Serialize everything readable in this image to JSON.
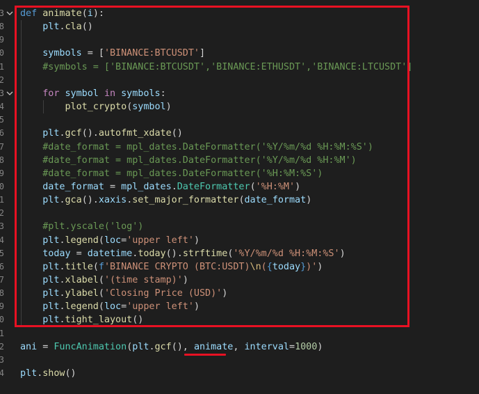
{
  "editor": {
    "lines": [
      {
        "n": "3",
        "fold": true,
        "tokens": [
          [
            "kw",
            "def"
          ],
          [
            "pun",
            " "
          ],
          [
            "fn",
            "animate"
          ],
          [
            "pun",
            "("
          ],
          [
            "var",
            "i"
          ],
          [
            "pun",
            "):"
          ]
        ]
      },
      {
        "n": "8",
        "tokens": [
          [
            "pun",
            "    "
          ],
          [
            "var",
            "plt"
          ],
          [
            "pun",
            "."
          ],
          [
            "fn",
            "cla"
          ],
          [
            "pun",
            "()"
          ]
        ]
      },
      {
        "n": "9",
        "tokens": []
      },
      {
        "n": "0",
        "tokens": [
          [
            "pun",
            "    "
          ],
          [
            "var",
            "symbols"
          ],
          [
            "pun",
            " = ["
          ],
          [
            "str",
            "'BINANCE:BTCUSDT'"
          ],
          [
            "pun",
            "]"
          ]
        ]
      },
      {
        "n": "1",
        "tokens": [
          [
            "pun",
            "    "
          ],
          [
            "com",
            "#symbols = ['BINANCE:BTCUSDT','BINANCE:ETHUSDT','BINANCE:LTCUSDT']"
          ]
        ]
      },
      {
        "n": "2",
        "tokens": []
      },
      {
        "n": "3",
        "fold": true,
        "tokens": [
          [
            "pun",
            "    "
          ],
          [
            "ctl",
            "for"
          ],
          [
            "pun",
            " "
          ],
          [
            "var",
            "symbol"
          ],
          [
            "pun",
            " "
          ],
          [
            "ctl",
            "in"
          ],
          [
            "pun",
            " "
          ],
          [
            "var",
            "symbols"
          ],
          [
            "pun",
            ":"
          ]
        ]
      },
      {
        "n": "4",
        "tokens": [
          [
            "pun",
            "        "
          ],
          [
            "fn",
            "plot_crypto"
          ],
          [
            "pun",
            "("
          ],
          [
            "var",
            "symbol"
          ],
          [
            "pun",
            ")"
          ]
        ]
      },
      {
        "n": "5",
        "tokens": []
      },
      {
        "n": "6",
        "tokens": [
          [
            "pun",
            "    "
          ],
          [
            "var",
            "plt"
          ],
          [
            "pun",
            "."
          ],
          [
            "fn",
            "gcf"
          ],
          [
            "pun",
            "()."
          ],
          [
            "fn",
            "autofmt_xdate"
          ],
          [
            "pun",
            "()"
          ]
        ]
      },
      {
        "n": "7",
        "tokens": [
          [
            "pun",
            "    "
          ],
          [
            "com",
            "#date_format = mpl_dates.DateFormatter('%Y/%m/%d %H:%M:%S')"
          ]
        ]
      },
      {
        "n": "8",
        "tokens": [
          [
            "pun",
            "    "
          ],
          [
            "com",
            "#date_format = mpl_dates.DateFormatter('%Y/%m/%d %H:%M')"
          ]
        ]
      },
      {
        "n": "9",
        "tokens": [
          [
            "pun",
            "    "
          ],
          [
            "com",
            "#date_format = mpl_dates.DateFormatter('%H:%M:%S')"
          ]
        ]
      },
      {
        "n": "0",
        "tokens": [
          [
            "pun",
            "    "
          ],
          [
            "var",
            "date_format"
          ],
          [
            "pun",
            " = "
          ],
          [
            "var",
            "mpl_dates"
          ],
          [
            "pun",
            "."
          ],
          [
            "cls",
            "DateFormatter"
          ],
          [
            "pun",
            "("
          ],
          [
            "str",
            "'%H:%M'"
          ],
          [
            "pun",
            ")"
          ]
        ]
      },
      {
        "n": "1",
        "tokens": [
          [
            "pun",
            "    "
          ],
          [
            "var",
            "plt"
          ],
          [
            "pun",
            "."
          ],
          [
            "fn",
            "gca"
          ],
          [
            "pun",
            "()."
          ],
          [
            "var",
            "xaxis"
          ],
          [
            "pun",
            "."
          ],
          [
            "fn",
            "set_major_formatter"
          ],
          [
            "pun",
            "("
          ],
          [
            "var",
            "date_format"
          ],
          [
            "pun",
            ")"
          ]
        ]
      },
      {
        "n": "2",
        "tokens": []
      },
      {
        "n": "3",
        "tokens": [
          [
            "pun",
            "    "
          ],
          [
            "com",
            "#plt.yscale('log')"
          ]
        ]
      },
      {
        "n": "4",
        "tokens": [
          [
            "pun",
            "    "
          ],
          [
            "var",
            "plt"
          ],
          [
            "pun",
            "."
          ],
          [
            "fn",
            "legend"
          ],
          [
            "pun",
            "("
          ],
          [
            "var",
            "loc"
          ],
          [
            "pun",
            "="
          ],
          [
            "str",
            "'upper left'"
          ],
          [
            "pun",
            ")"
          ]
        ]
      },
      {
        "n": "5",
        "tokens": [
          [
            "pun",
            "    "
          ],
          [
            "var",
            "today"
          ],
          [
            "pun",
            " = "
          ],
          [
            "var",
            "datetime"
          ],
          [
            "pun",
            "."
          ],
          [
            "fn",
            "today"
          ],
          [
            "pun",
            "()."
          ],
          [
            "fn",
            "strftime"
          ],
          [
            "pun",
            "("
          ],
          [
            "str",
            "'%Y/%m/%d %H:%M:%S'"
          ],
          [
            "pun",
            ")"
          ]
        ]
      },
      {
        "n": "6",
        "tokens": [
          [
            "pun",
            "    "
          ],
          [
            "var",
            "plt"
          ],
          [
            "pun",
            "."
          ],
          [
            "fn",
            "title"
          ],
          [
            "pun",
            "("
          ],
          [
            "kw",
            "f"
          ],
          [
            "str",
            "'BINANCE CRYPTO (BTC:USDT)"
          ],
          [
            "esc",
            "\\n"
          ],
          [
            "str",
            "("
          ],
          [
            "kw",
            "{"
          ],
          [
            "var",
            "today"
          ],
          [
            "kw",
            "}"
          ],
          [
            "str",
            ")'"
          ],
          [
            "pun",
            ")"
          ]
        ]
      },
      {
        "n": "7",
        "tokens": [
          [
            "pun",
            "    "
          ],
          [
            "var",
            "plt"
          ],
          [
            "pun",
            "."
          ],
          [
            "fn",
            "xlabel"
          ],
          [
            "pun",
            "("
          ],
          [
            "str",
            "'(time stamp)'"
          ],
          [
            "pun",
            ")"
          ]
        ]
      },
      {
        "n": "8",
        "tokens": [
          [
            "pun",
            "    "
          ],
          [
            "var",
            "plt"
          ],
          [
            "pun",
            "."
          ],
          [
            "fn",
            "ylabel"
          ],
          [
            "pun",
            "("
          ],
          [
            "str",
            "'Closing Price (USD)'"
          ],
          [
            "pun",
            ")"
          ]
        ]
      },
      {
        "n": "9",
        "tokens": [
          [
            "pun",
            "    "
          ],
          [
            "var",
            "plt"
          ],
          [
            "pun",
            "."
          ],
          [
            "fn",
            "legend"
          ],
          [
            "pun",
            "("
          ],
          [
            "var",
            "loc"
          ],
          [
            "pun",
            "="
          ],
          [
            "str",
            "'upper left'"
          ],
          [
            "pun",
            ")"
          ]
        ]
      },
      {
        "n": "0",
        "tokens": [
          [
            "pun",
            "    "
          ],
          [
            "var",
            "plt"
          ],
          [
            "pun",
            "."
          ],
          [
            "fn",
            "tight_layout"
          ],
          [
            "pun",
            "()"
          ]
        ]
      },
      {
        "n": "1",
        "tokens": []
      },
      {
        "n": "2",
        "tokens": [
          [
            "var",
            "ani"
          ],
          [
            "pun",
            " = "
          ],
          [
            "cls",
            "FuncAnimation"
          ],
          [
            "pun",
            "("
          ],
          [
            "var",
            "plt"
          ],
          [
            "pun",
            "."
          ],
          [
            "fn",
            "gcf"
          ],
          [
            "pun",
            "(), "
          ],
          [
            "var",
            "animate"
          ],
          [
            "pun",
            ", "
          ],
          [
            "var",
            "interval"
          ],
          [
            "pun",
            "="
          ],
          [
            "num",
            "1000"
          ],
          [
            "pun",
            ")"
          ]
        ]
      },
      {
        "n": "3",
        "tokens": []
      },
      {
        "n": "4",
        "tokens": [
          [
            "var",
            "plt"
          ],
          [
            "pun",
            "."
          ],
          [
            "fn",
            "show"
          ],
          [
            "pun",
            "()"
          ]
        ]
      }
    ]
  },
  "colors": {
    "highlight_box": "#e81123",
    "underline": "#e81123",
    "background": "#1e1e1e"
  }
}
